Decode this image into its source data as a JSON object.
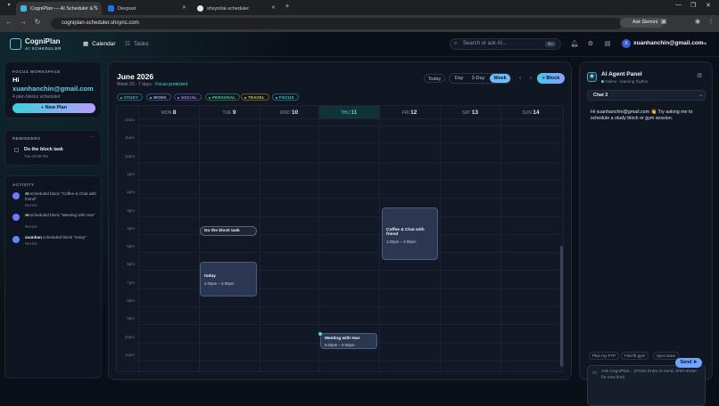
{
  "browser": {
    "tabs": [
      {
        "title": "CogniPlan — AI Scheduler & S",
        "active": true
      },
      {
        "title": "Devpost",
        "active": false
      },
      {
        "title": "shsyni/ai-scheduler",
        "active": false
      }
    ],
    "url": "cogniplan-scheduler.shsync.com",
    "gemini_label": "Ask Gemini"
  },
  "header": {
    "brand": "CogniPlan",
    "brand_sub": "AI SCHEDULER",
    "nav": [
      {
        "label": "Calendar"
      },
      {
        "label": "Tasks"
      }
    ],
    "search_placeholder": "Search or ask AI...",
    "search_kbd": "⌘K",
    "user_email": "xuanhanchin@gmail.com",
    "avatar_letter": "X"
  },
  "sidebar": {
    "focus_label": "FOCUS WORKSPACE",
    "greeting": "Hi",
    "email": "xuanhanchin@gmail.com",
    "subtitle": "4 plan blocks scheduled",
    "new_plan": "+ New Plan",
    "reminders_label": "REMINDERS",
    "reminders_more": "···",
    "reminders": [
      {
        "title": "Do the block task",
        "time": "Tue 02:00 PM"
      }
    ],
    "activity_label": "ACTIVITY",
    "activity": [
      {
        "actor": "AI",
        "text": "scheduled block \"Coffee & Chat with friend\"",
        "when": "Recent"
      },
      {
        "actor": "AI",
        "text": "scheduled block \"Meeting with Han\"",
        "when": "Recent"
      },
      {
        "actor": "xuanhan",
        "text": "scheduled block \"today\"",
        "when": "Recent"
      }
    ]
  },
  "calendar": {
    "month": "June 2026",
    "week_info": "Week 23 · 7 days ·",
    "focus_status": "Focus protected",
    "today_btn": "Today",
    "views": [
      "Day",
      "3-Day",
      "Week"
    ],
    "active_view": "Week",
    "add_block": "+ Block",
    "chips": [
      {
        "label": "STUDY",
        "color": "#37c6d0"
      },
      {
        "label": "WORK",
        "color": "#7aa2ff"
      },
      {
        "label": "SOCIAL",
        "color": "#b48cff"
      },
      {
        "label": "PERSONAL",
        "color": "#4fd39a"
      },
      {
        "label": "TRAVEL",
        "color": "#f0c040"
      },
      {
        "label": "FOCUS",
        "color": "#3fd6e0"
      }
    ],
    "days": [
      {
        "dow": "MON",
        "num": "8"
      },
      {
        "dow": "TUE",
        "num": "9"
      },
      {
        "dow": "WED",
        "num": "10"
      },
      {
        "dow": "THU",
        "num": "11"
      },
      {
        "dow": "FRI",
        "num": "12"
      },
      {
        "dow": "SAT",
        "num": "13"
      },
      {
        "dow": "SUN",
        "num": "14"
      }
    ],
    "hours": [
      "10am",
      "11am",
      "12pm",
      "1pm",
      "2pm",
      "3pm",
      "4pm",
      "5pm",
      "6pm",
      "7pm",
      "8pm",
      "9pm",
      "10pm",
      "11pm"
    ],
    "events": [
      {
        "title": "Do the block task",
        "time": ""
      },
      {
        "title": "today",
        "time": "4:00pm – 6:00pm"
      },
      {
        "title": "Coffee & Chat with friend",
        "time": "1:00pm – 4:00pm"
      },
      {
        "title": "Meeting with Han",
        "time": "8:00pm – 9:00pm"
      }
    ]
  },
  "agent": {
    "title": "AI Agent Panel",
    "status": "Online · learning rhythm",
    "chat_select": "Chat 3",
    "message": "Hi xuanhanchin@gmail.com 👋 Try asking me to schedule a study block or gym session.",
    "suggestions": [
      "Plan my FYP",
      "Find fit gym",
      "Sync team"
    ],
    "input_placeholder": "Ask CogniPlan... (Press Enter to send, Shift+Enter for new line)",
    "send": "Send"
  }
}
